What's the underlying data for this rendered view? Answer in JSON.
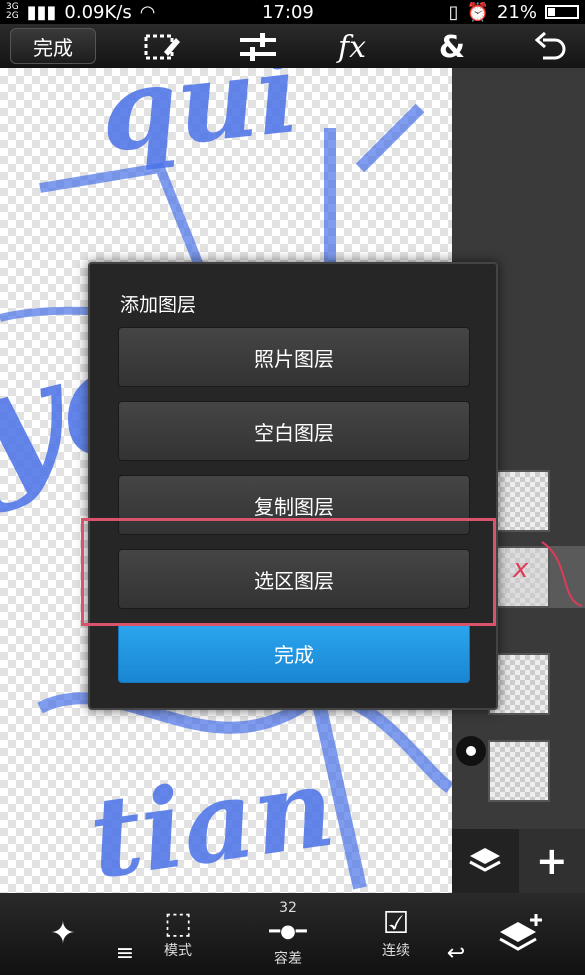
{
  "status_bar": {
    "network_top": "3G",
    "network_bottom": "2G",
    "speed": "0.09K/s",
    "time": "17:09",
    "battery": "21%"
  },
  "toolbar": {
    "done_label": "完成",
    "icons": [
      "selection-edit-icon",
      "adjust-sliders-icon",
      "fx-icon",
      "ampersand-icon",
      "undo-icon"
    ],
    "fx_label": "fx",
    "amp_label": "&"
  },
  "dialog": {
    "title": "添加图层",
    "buttons": [
      {
        "label": "照片图层"
      },
      {
        "label": "空白图层"
      },
      {
        "label": "复制图层"
      },
      {
        "label": "选区图层"
      }
    ],
    "done_label": "完成"
  },
  "canvas_art": {
    "text1": "qui",
    "text2": "you",
    "text3": "tian"
  },
  "bottom_bar": {
    "mode_label": "模式",
    "tolerance_value": "32",
    "tolerance_label": "容差",
    "continuous_label": "连续"
  },
  "colors": {
    "accent_blue": "#1f95e0",
    "annotation_red": "#d9536a",
    "art_blue": "#4a72e8"
  }
}
